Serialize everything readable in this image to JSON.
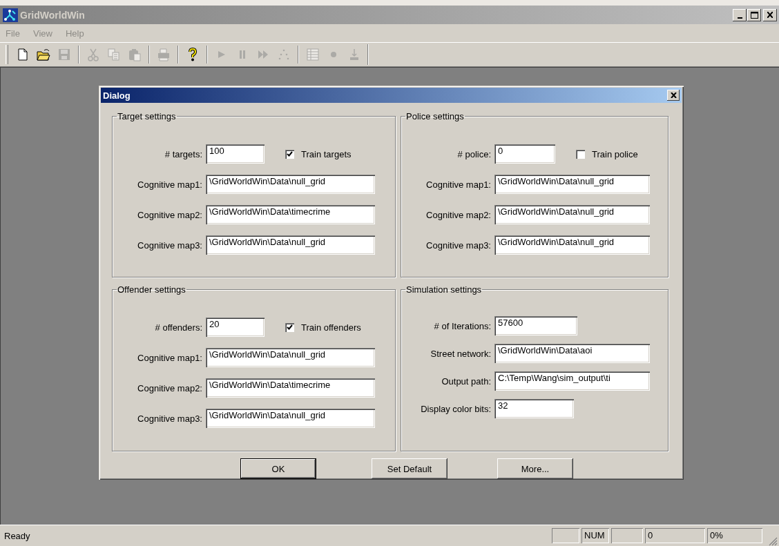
{
  "window": {
    "title": "GridWorldWin"
  },
  "menu": [
    "File",
    "View",
    "Help"
  ],
  "toolbar": [
    {
      "kind": "new",
      "disabled": false
    },
    {
      "kind": "open",
      "disabled": false
    },
    {
      "kind": "save",
      "disabled": true
    },
    {
      "kind": "separator"
    },
    {
      "kind": "cut",
      "disabled": true
    },
    {
      "kind": "copy",
      "disabled": true
    },
    {
      "kind": "paste",
      "disabled": true
    },
    {
      "kind": "separator"
    },
    {
      "kind": "print",
      "disabled": true
    },
    {
      "kind": "separator"
    },
    {
      "kind": "help",
      "disabled": false
    },
    {
      "kind": "separator"
    },
    {
      "kind": "play",
      "disabled": true
    },
    {
      "kind": "pause",
      "disabled": true
    },
    {
      "kind": "fast-forward",
      "disabled": true
    },
    {
      "kind": "scatter",
      "disabled": true
    },
    {
      "kind": "separator"
    },
    {
      "kind": "grid",
      "disabled": true
    },
    {
      "kind": "dot",
      "disabled": true
    },
    {
      "kind": "download",
      "disabled": true
    }
  ],
  "dialog": {
    "title": "Dialog",
    "groups": [
      {
        "title": "Target settings",
        "count": {
          "label": "# targets:",
          "value": "100"
        },
        "checkbox": {
          "label": "Train targets",
          "checked": true
        },
        "fields": [
          {
            "label": "Cognitive map1:",
            "value": "\\GridWorldWin\\Data\\null_grid"
          },
          {
            "label": "Cognitive map2:",
            "value": "\\GridWorldWin\\Data\\timecrime"
          },
          {
            "label": "Cognitive map3:",
            "value": "\\GridWorldWin\\Data\\null_grid"
          }
        ]
      },
      {
        "title": "Police settings",
        "count": {
          "label": "# police:",
          "value": "0"
        },
        "checkbox": {
          "label": "Train police",
          "checked": false
        },
        "fields": [
          {
            "label": "Cognitive map1:",
            "value": "\\GridWorldWin\\Data\\null_grid"
          },
          {
            "label": "Cognitive map2:",
            "value": "\\GridWorldWin\\Data\\null_grid"
          },
          {
            "label": "Cognitive map3:",
            "value": "\\GridWorldWin\\Data\\null_grid"
          }
        ]
      },
      {
        "title": "Offender settings",
        "count": {
          "label": "# offenders:",
          "value": "20"
        },
        "checkbox": {
          "label": "Train offenders",
          "checked": true
        },
        "fields": [
          {
            "label": "Cognitive map1:",
            "value": "\\GridWorldWin\\Data\\null_grid"
          },
          {
            "label": "Cognitive map2:",
            "value": "\\GridWorldWin\\Data\\timecrime"
          },
          {
            "label": "Cognitive map3:",
            "value": "\\GridWorldWin\\Data\\null_grid"
          }
        ]
      },
      {
        "title": "Simulation settings",
        "fields": [
          {
            "label": "# of Iterations:",
            "value": "57600",
            "kind": "short"
          },
          {
            "label": "Street network:",
            "value": "\\GridWorldWin\\Data\\aoi",
            "kind": "long"
          },
          {
            "label": "Output path:",
            "value": "C:\\Temp\\Wang\\sim_output\\ti",
            "kind": "long"
          },
          {
            "label": "Display color bits:",
            "value": "32",
            "kind": "short"
          }
        ]
      }
    ],
    "buttons": [
      {
        "label": "OK",
        "default": true
      },
      {
        "label": "Set Default",
        "default": false
      },
      {
        "label": "More...",
        "default": false
      }
    ]
  },
  "status_bar": {
    "message": "Ready",
    "panes": [
      {
        "kind": "blank"
      },
      {
        "kind": "text",
        "text": "NUM"
      },
      {
        "kind": "blank"
      },
      {
        "kind": "text",
        "text": "0"
      },
      {
        "kind": "text",
        "text": "0%"
      }
    ]
  }
}
